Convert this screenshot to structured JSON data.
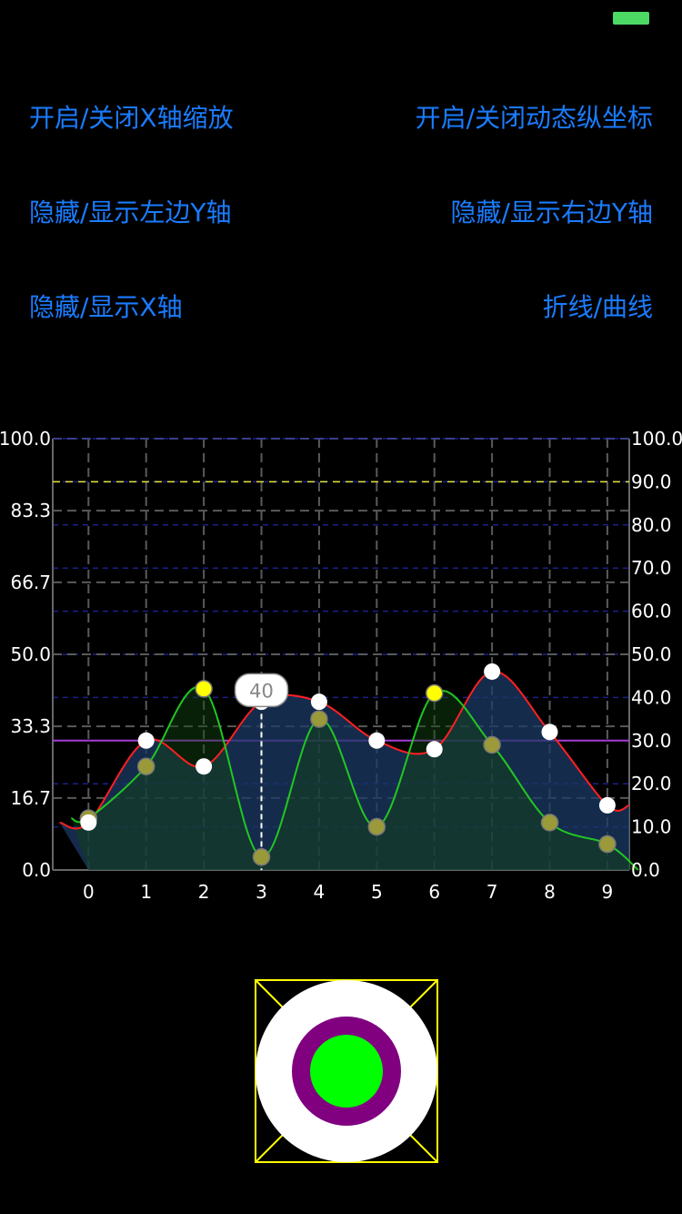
{
  "status_bar": {
    "battery_color": "#4cd964"
  },
  "controls": {
    "toggle_x_zoom": "开启/关闭X轴缩放",
    "toggle_dynamic_y": "开启/关闭动态纵坐标",
    "toggle_left_y": "隐藏/显示左边Y轴",
    "toggle_right_y": "隐藏/显示右边Y轴",
    "toggle_x_axis": "隐藏/显示X轴",
    "line_curve": "折线/曲线"
  },
  "chart_data": {
    "type": "line",
    "categories": [
      "0",
      "1",
      "2",
      "3",
      "4",
      "5",
      "6",
      "7",
      "8",
      "9"
    ],
    "series": [
      {
        "values": [
          11,
          30,
          24,
          39,
          39,
          30,
          28,
          46,
          32,
          15
        ],
        "color": "#ff2020",
        "point_color": "#ffffff",
        "filled": true
      },
      {
        "values": [
          12,
          24,
          42,
          3,
          35,
          10,
          41,
          29,
          11,
          6
        ],
        "color": "#22c722",
        "point_color": "#9a9a3a",
        "highlight_color": "#ffff00"
      }
    ],
    "y_left": {
      "ticks": [
        "0.0",
        "16.7",
        "33.3",
        "50.0",
        "66.7",
        "83.3",
        "100.0"
      ],
      "ylim": [
        0,
        100
      ]
    },
    "y_right": {
      "ticks": [
        "0.0",
        "10.0",
        "20.0",
        "30.0",
        "40.0",
        "50.0",
        "60.0",
        "70.0",
        "80.0",
        "90.0",
        "100.0"
      ],
      "ylim": [
        0,
        100
      ]
    },
    "limit_lines": [
      {
        "value": 90,
        "color": "#e5e53a",
        "style": "dashed"
      },
      {
        "value": 30,
        "color": "#a43ed6",
        "style": "solid"
      }
    ],
    "highlight": {
      "index": 3,
      "label": "40"
    },
    "grid": true
  },
  "marker": {
    "outer_color": "#ffffff",
    "ring_color": "#800080",
    "center_color": "#00ff00",
    "frame_color": "#ffff00"
  }
}
